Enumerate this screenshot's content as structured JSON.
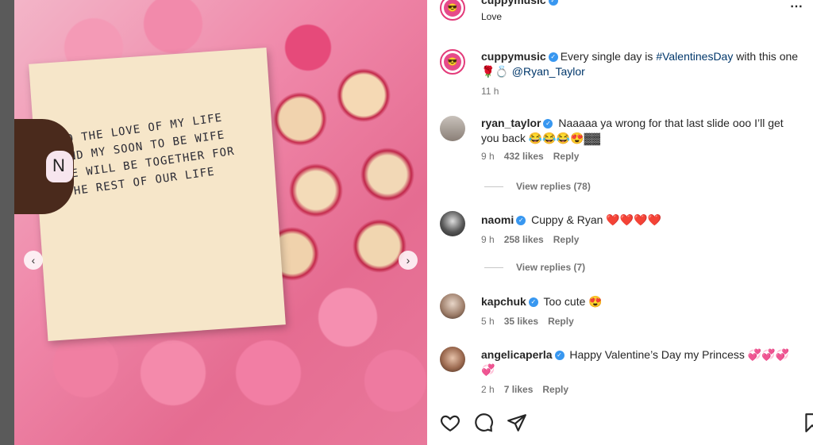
{
  "post": {
    "header": {
      "username": "cuppymusic",
      "location": "Love"
    },
    "caption": {
      "username": "cuppymusic",
      "text_before": "Every single day is ",
      "hashtag": "#ValentinesDay",
      "text_mid": " with this one 🌹💍 ",
      "mention": "@Ryan_Taylor",
      "time": "11 h"
    },
    "card_text": "To the love of my life and my soon to be wife we will be together for the rest of our life",
    "nail_letter": "N"
  },
  "comments": [
    {
      "username": "ryan_taylor",
      "text": "Naaaaa ya wrong for that last slide ooo I’ll get you back 😂😂😂😍▓▓",
      "time": "9 h",
      "likes": "432 likes",
      "reply": "Reply",
      "view_replies": "View replies (78)"
    },
    {
      "username": "naomi",
      "text": "Cuppy & Ryan ❤️❤️❤️❤️",
      "time": "9 h",
      "likes": "258 likes",
      "reply": "Reply",
      "view_replies": "View replies (7)"
    },
    {
      "username": "kapchuk",
      "text": "Too cute 😍",
      "time": "5 h",
      "likes": "35 likes",
      "reply": "Reply"
    },
    {
      "username": "angelicaperla",
      "text": "Happy Valentine’s Day my Princess 💞💞💞💞",
      "time": "2 h",
      "likes": "7 likes",
      "reply": "Reply"
    }
  ],
  "colors": {
    "verified": "#3897f0",
    "link": "#00376b",
    "ring": "#e33b7a"
  },
  "icons": [
    "heart-icon",
    "comment-icon",
    "share-icon",
    "bookmark-icon",
    "more-icon",
    "chevron-left-icon",
    "chevron-right-icon",
    "verified-icon"
  ]
}
